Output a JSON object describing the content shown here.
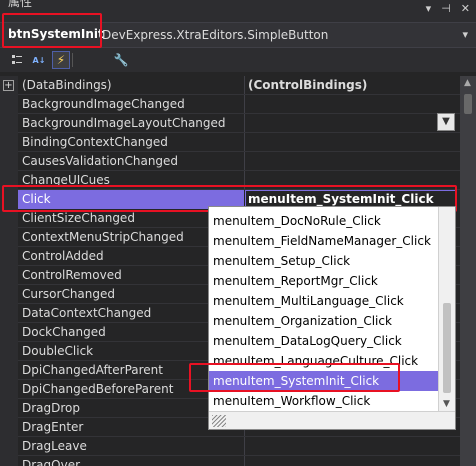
{
  "window": {
    "title": "属性"
  },
  "object_selector": {
    "name": "btnSystemInit",
    "type": "DevExpress.XtraEditors.SimpleButton"
  },
  "toolbar": {
    "icons": [
      "categorized-icon",
      "alphabetical-icon",
      "events-icon",
      "property-pages-icon"
    ]
  },
  "properties": [
    {
      "name": "(DataBindings)",
      "value": "(ControlBindings)",
      "expandable": true
    },
    {
      "name": "BackgroundImageChanged",
      "value": ""
    },
    {
      "name": "BackgroundImageLayoutChanged",
      "value": ""
    },
    {
      "name": "BindingContextChanged",
      "value": ""
    },
    {
      "name": "CausesValidationChanged",
      "value": ""
    },
    {
      "name": "ChangeUICues",
      "value": ""
    },
    {
      "name": "Click",
      "value": "menuItem_SystemInit_Click",
      "selected": true
    },
    {
      "name": "ClientSizeChanged",
      "value": ""
    },
    {
      "name": "ContextMenuStripChanged",
      "value": ""
    },
    {
      "name": "ControlAdded",
      "value": ""
    },
    {
      "name": "ControlRemoved",
      "value": ""
    },
    {
      "name": "CursorChanged",
      "value": ""
    },
    {
      "name": "DataContextChanged",
      "value": ""
    },
    {
      "name": "DockChanged",
      "value": ""
    },
    {
      "name": "DoubleClick",
      "value": ""
    },
    {
      "name": "DpiChangedAfterParent",
      "value": ""
    },
    {
      "name": "DpiChangedBeforeParent",
      "value": ""
    },
    {
      "name": "DragDrop",
      "value": ""
    },
    {
      "name": "DragEnter",
      "value": ""
    },
    {
      "name": "DragLeave",
      "value": ""
    },
    {
      "name": "DragOver",
      "value": ""
    }
  ],
  "dropdown": {
    "items": [
      "menuItem_DocNoRule_Click",
      "menuItem_FieldNameManager_Click",
      "menuItem_Setup_Click",
      "menuItem_ReportMgr_Click",
      "menuItem_MultiLanguage_Click",
      "menuItem_Organization_Click",
      "menuItem_DataLogQuery_Click",
      "menuItem_LanguageCulture_Click",
      "menuItem_SystemInit_Click",
      "menuItem_Workflow_Click"
    ],
    "highlighted": "menuItem_SystemInit_Click"
  },
  "colors": {
    "accent": "#7c6ce0",
    "highlight_box": "#e81123",
    "background": "#252526"
  }
}
